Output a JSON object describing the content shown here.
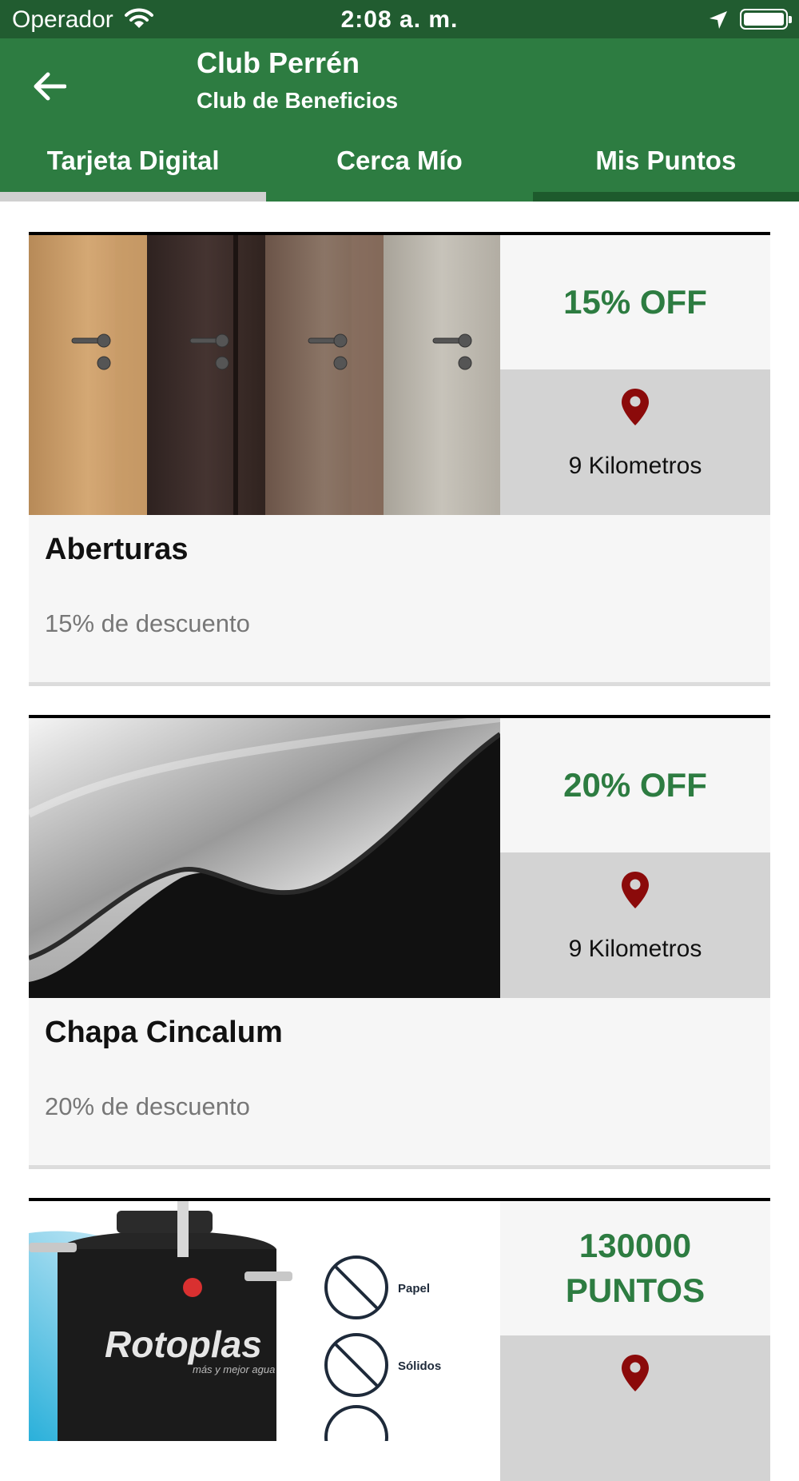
{
  "status_bar": {
    "carrier": "Operador",
    "time": "2:08 a. m."
  },
  "header": {
    "title": "Club Perrén",
    "subtitle": "Club de Beneficios"
  },
  "tabs": [
    {
      "label": "Tarjeta Digital",
      "selected": true
    },
    {
      "label": "Cerca Mío",
      "selected": false
    },
    {
      "label": "Mis Puntos",
      "selected": false
    }
  ],
  "colors": {
    "status_bar": "#215c30",
    "app_bar": "#2d7c41",
    "offer_text": "#2d7c41",
    "pin": "#8b0a0a",
    "tab_indicator_active": "#d0d0d0",
    "tab_indicator_inactive": "#1d5a2c"
  },
  "benefits": [
    {
      "offer": "15% OFF",
      "distance": "9 Kilometros",
      "name": "Aberturas",
      "description": "15% de descuento",
      "image": "doors-photo"
    },
    {
      "offer": "20% OFF",
      "distance": "9 Kilometros",
      "name": "Chapa Cincalum",
      "description": "20% de descuento",
      "image": "corrugated-sheet-photo"
    },
    {
      "offer": "130000 PUNTOS",
      "distance": "",
      "name": "",
      "description": "",
      "image": "water-tank-photo",
      "image_labels": {
        "brand": "Rotoplas",
        "tagline": "más y mejor agua",
        "icon_1": "Papel",
        "icon_2": "Sólidos"
      }
    }
  ]
}
